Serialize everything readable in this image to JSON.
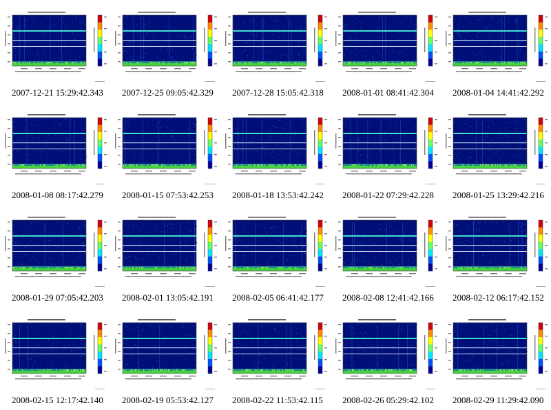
{
  "colors": {
    "background": "#ffffff",
    "spectrogram_bg": "#000f78",
    "line_cyan": "#40e0d0",
    "line_white": "#c8e6ff",
    "noise_green": "#46d23c",
    "colorbar": [
      "#d2000a",
      "#ff8c00",
      "#ffff00",
      "#64ff64",
      "#00e6ff",
      "#0050ff",
      "#000096"
    ]
  },
  "thumbnails": [
    {
      "caption": "2007-12-21 15:29:42.343"
    },
    {
      "caption": "2007-12-25 09:05:42.329"
    },
    {
      "caption": "2007-12-28 15:05:42.318"
    },
    {
      "caption": "2008-01-01 08:41:42.304"
    },
    {
      "caption": "2008-01-04 14:41:42.292"
    },
    {
      "caption": "2008-01-08 08:17:42.279"
    },
    {
      "caption": "2008-01-15 07:53:42.253"
    },
    {
      "caption": "2008-01-18 13:53:42.242"
    },
    {
      "caption": "2008-01-22 07:29:42.228"
    },
    {
      "caption": "2008-01-25 13:29:42.216"
    },
    {
      "caption": "2008-01-29 07:05:42.203"
    },
    {
      "caption": "2008-02-01 13:05:42.191"
    },
    {
      "caption": "2008-02-05 06:41:42.177"
    },
    {
      "caption": "2008-02-08 12:41:42.166"
    },
    {
      "caption": "2008-02-12 06:17:42.152"
    },
    {
      "caption": "2008-02-15 12:17:42.140"
    },
    {
      "caption": "2008-02-19 05:53:42.127"
    },
    {
      "caption": "2008-02-22 11:53:42.115"
    },
    {
      "caption": "2008-02-26 05:29:42.102"
    },
    {
      "caption": "2008-02-29 11:29:42.090"
    }
  ]
}
